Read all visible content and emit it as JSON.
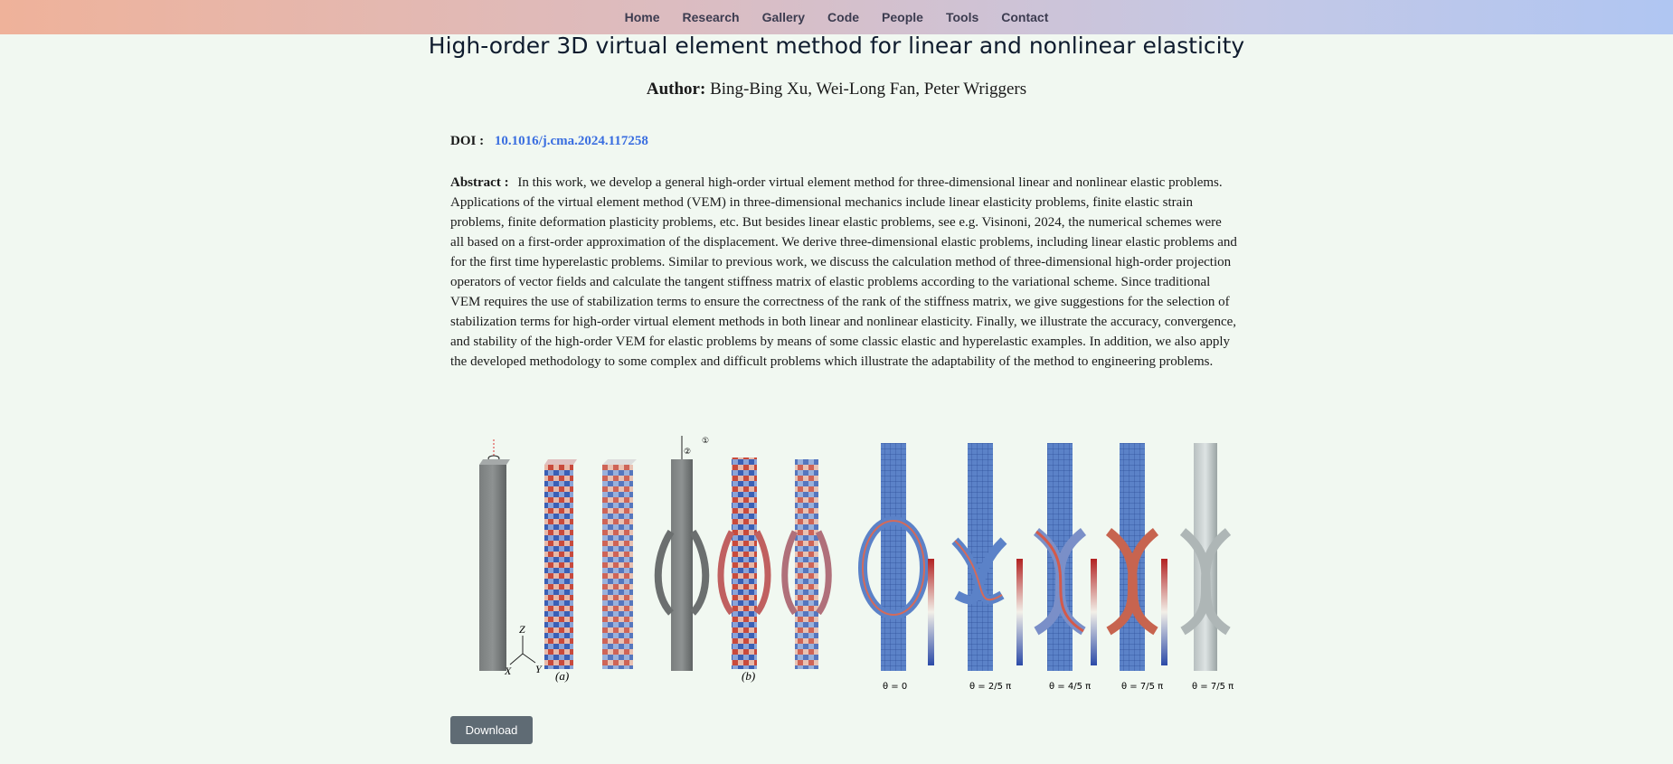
{
  "nav": {
    "items": [
      "Home",
      "Research",
      "Gallery",
      "Code",
      "People",
      "Tools",
      "Contact"
    ]
  },
  "paper": {
    "title": "High-order 3D virtual element method for linear and nonlinear elasticity",
    "author_label": "Author:",
    "authors": "Bing-Bing Xu, Wei-Long Fan, Peter Wriggers",
    "doi_label": "DOI :",
    "doi": "10.1016/j.cma.2024.117258",
    "abstract_label": "Abstract :",
    "abstract": "In this work, we develop a general high-order virtual element method for three-dimensional linear and nonlinear elastic problems. Applications of the virtual element method (VEM) in three-dimensional mechanics include linear elasticity problems, finite elastic strain problems, finite deformation plasticity problems, etc. But besides linear elastic problems, see e.g. Visinoni, 2024, the numerical schemes were all based on a first-order approximation of the displacement. We derive three-dimensional elastic problems, including linear elastic problems and for the first time hyperelastic problems. Similar to previous work, we discuss the calculation method of three-dimensional high-order projection operators of vector fields and calculate the tangent stiffness matrix of elastic problems according to the variational scheme. Since traditional VEM requires the use of stabilization terms to ensure the correctness of the rank of the stiffness matrix, we give suggestions for the selection of stabilization terms for high-order virtual element methods in both linear and nonlinear elasticity. Finally, we illustrate the accuracy, convergence, and stability of the high-order VEM for elastic problems by means of some classic elastic and hyperelastic examples. In addition, we also apply the developed methodology to some complex and difficult problems which illustrate the adaptability of the method to engineering problems."
  },
  "figure": {
    "panel_a": "(a)",
    "panel_b": "(b)",
    "axis_z": "Z",
    "axis_x": "X",
    "axis_y": "Y",
    "marker_1": "①",
    "marker_2": "②",
    "theta_labels": [
      "θ = 0",
      "θ = 2/5 π",
      "θ = 4/5 π",
      "θ = 7/5 π",
      "θ = 7/5 π"
    ]
  },
  "actions": {
    "download": "Download"
  }
}
